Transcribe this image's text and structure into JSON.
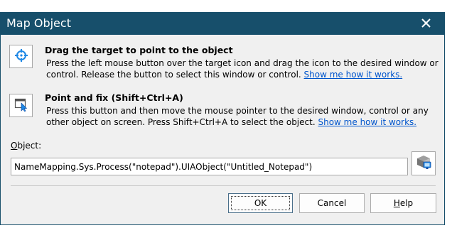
{
  "window": {
    "title": "Map Object",
    "close_icon": "close-icon"
  },
  "drag_target": {
    "icon": "crosshair-target-icon",
    "title": "Drag the target to point to the object",
    "description": "Press the left mouse button over the target icon and drag the icon to the desired window or control. Release the button to select this window or control.",
    "link": "Show me how it works."
  },
  "point_fix": {
    "icon": "cursor-window-icon",
    "title": "Point and fix (Shift+Ctrl+A)",
    "description": "Press this button and then move the mouse pointer to the desired window, control or any other object on screen. Press Shift+Ctrl+A to select the object.",
    "link": "Show me how it works."
  },
  "object": {
    "label_first": "O",
    "label_rest": "bject:",
    "value": "NameMapping.Sys.Process(\"notepad\").UIAObject(\"Untitled_Notepad\")",
    "picker_icon": "object-browser-icon"
  },
  "buttons": {
    "ok": "OK",
    "cancel": "Cancel",
    "help_first": "H",
    "help_rest": "elp"
  },
  "colors": {
    "titlebar": "#174f6b",
    "link": "#0055cc",
    "accent_blue": "#1e88e5"
  }
}
